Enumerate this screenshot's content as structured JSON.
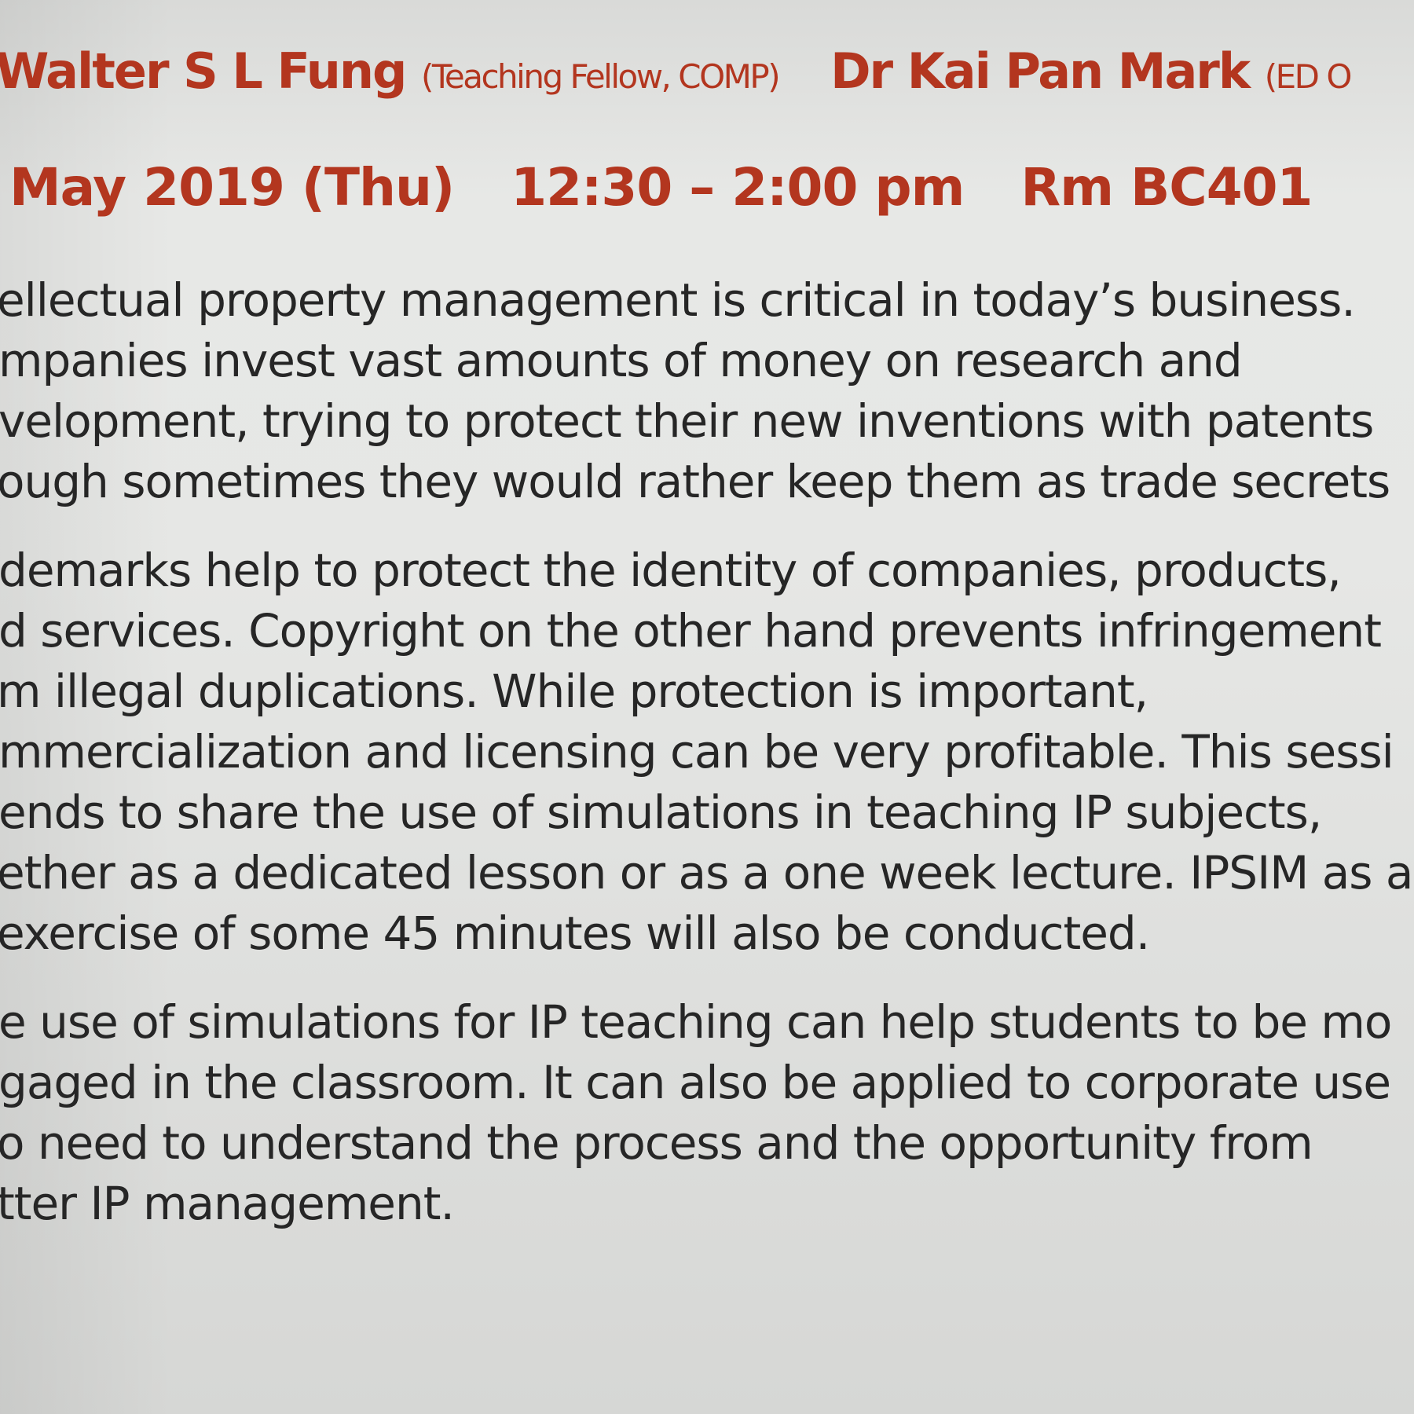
{
  "header": {
    "speaker_1_name": "Walter S L Fung",
    "speaker_1_affiliation": "(Teaching Fellow, COMP)",
    "speaker_2_name": "Dr Kai Pan Mark",
    "speaker_2_affiliation": "(ED O",
    "date": "May 2019 (Thu)",
    "time": "12:30 – 2:00 pm",
    "room": "Rm BC401"
  },
  "paragraph_1": [
    "ellectual property management is critical in today’s business.",
    "mpanies invest vast amounts of money on research and",
    "velopment, trying to protect their new inventions with patents",
    "ough sometimes they would rather keep them as trade secrets"
  ],
  "paragraph_2": [
    "demarks help to protect the identity of  companies, products,",
    "d services. Copyright on the other hand prevents infringement",
    "m illegal duplications. While protection is important,",
    "mmercialization and licensing can be very profitable. This sessi",
    "ends to share the use of simulations in teaching IP subjects,",
    "ether as a dedicated lesson or as a one week lecture. IPSIM as a",
    " exercise of some 45 minutes will also be conducted."
  ],
  "paragraph_3": [
    "e use of simulations for IP teaching can help students to be mo",
    "gaged in the classroom. It can also be applied to corporate use",
    "o need to understand the process and the opportunity from",
    "tter IP management."
  ],
  "colors": {
    "accent_red": "#b3361f",
    "body_text": "#262626",
    "background": "#e4e5e3"
  }
}
